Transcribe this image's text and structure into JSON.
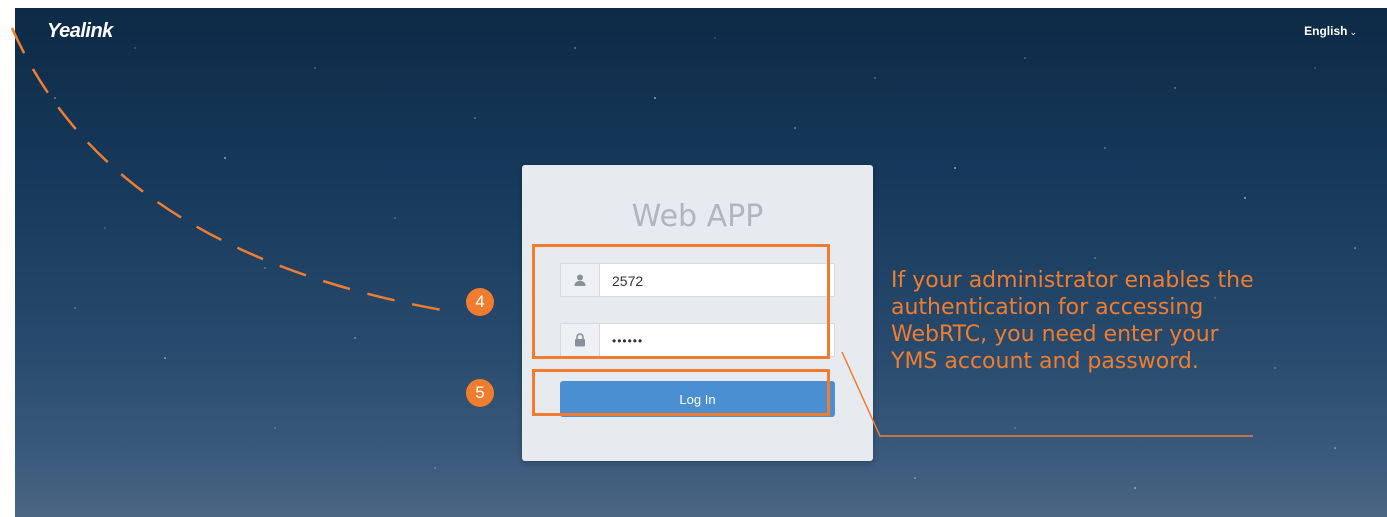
{
  "header": {
    "logo": "Yealink",
    "language": "English",
    "language_chevron": "chevron-down-icon"
  },
  "login": {
    "title": "Web APP",
    "username_value": "2572",
    "username_icon": "user-icon",
    "password_value": "••••••",
    "password_icon": "lock-icon",
    "login_label": "Log In",
    "button_color": "#4a8fd1"
  },
  "annotations": {
    "step_fields": "4",
    "step_login": "5",
    "note": "If your administrator enables the authentication for accessing WebRTC, you need enter your YMS account and password.",
    "accent_color": "#f07d2f"
  }
}
